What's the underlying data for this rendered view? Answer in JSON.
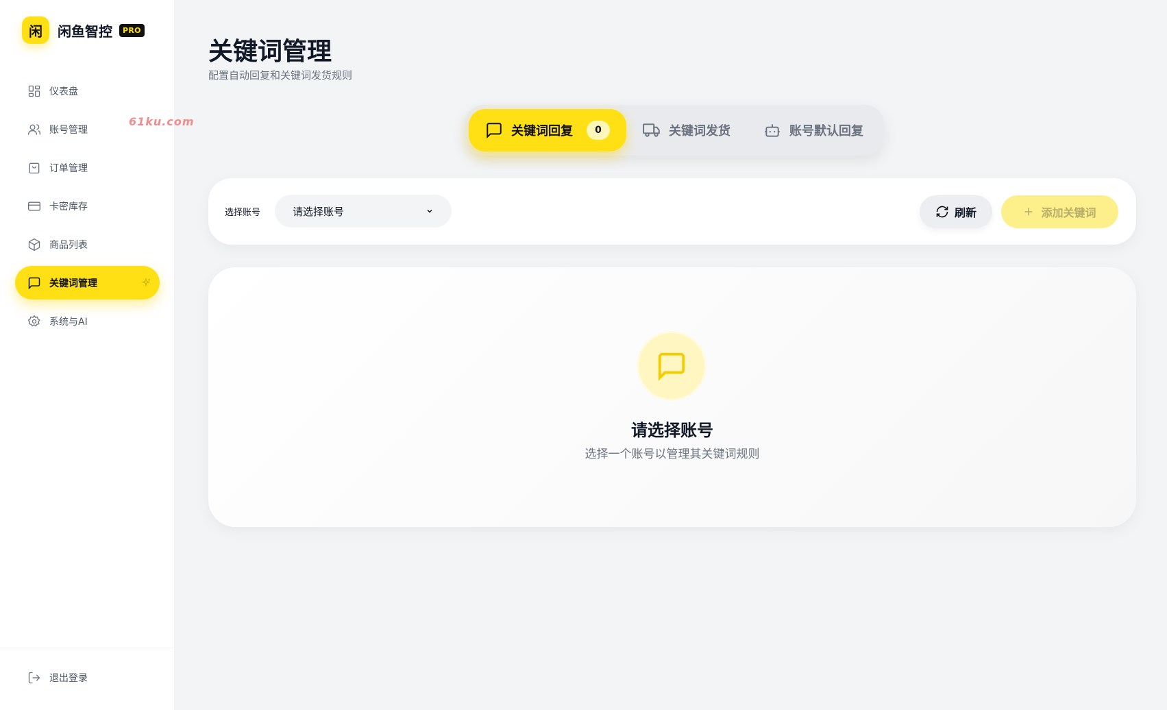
{
  "brand": {
    "logo_char": "闲",
    "name": "闲鱼智控",
    "badge": "PRO"
  },
  "watermark": "61ku.com",
  "sidebar": {
    "items": [
      {
        "label": "仪表盘",
        "icon": "dashboard-icon"
      },
      {
        "label": "账号管理",
        "icon": "users-icon"
      },
      {
        "label": "订单管理",
        "icon": "shopping-bag-icon"
      },
      {
        "label": "卡密库存",
        "icon": "credit-card-icon"
      },
      {
        "label": "商品列表",
        "icon": "box-icon"
      },
      {
        "label": "关键词管理",
        "icon": "message-square-icon",
        "active": true
      },
      {
        "label": "系统与AI",
        "icon": "gear-icon"
      }
    ],
    "logout": "退出登录"
  },
  "page": {
    "title": "关键词管理",
    "subtitle": "配置自动回复和关键词发货规则"
  },
  "tabs": [
    {
      "label": "关键词回复",
      "count": "0",
      "active": true,
      "icon": "message-square-icon"
    },
    {
      "label": "关键词发货",
      "active": false,
      "icon": "truck-icon"
    },
    {
      "label": "账号默认回复",
      "active": false,
      "icon": "bot-icon"
    }
  ],
  "toolbar": {
    "account_label": "选择账号",
    "account_select_value": "请选择账号",
    "refresh_label": "刷新",
    "add_label": "添加关键词"
  },
  "empty_state": {
    "title": "请选择账号",
    "description": "选择一个账号以管理其关键词规则"
  },
  "colors": {
    "accent": "#ffe014",
    "accent_soft": "#fdf08a",
    "background": "#f3f4f6"
  }
}
